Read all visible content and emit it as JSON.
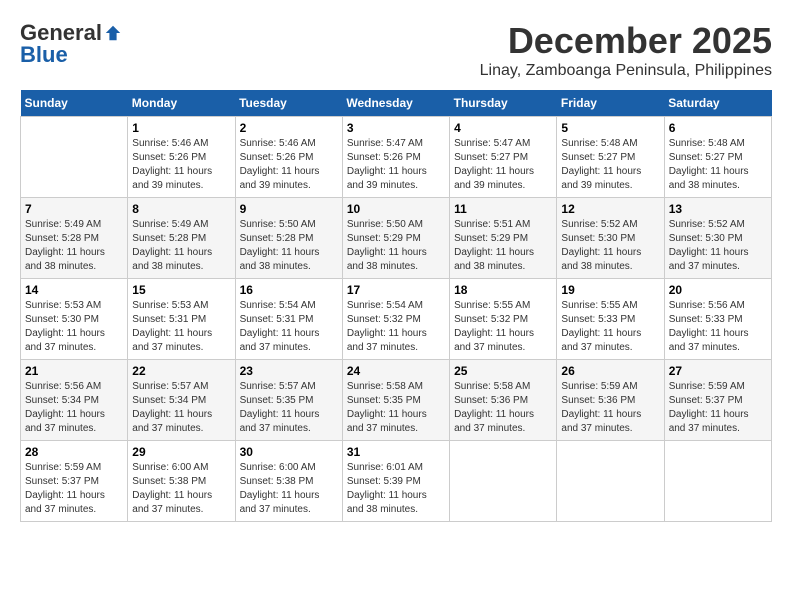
{
  "logo": {
    "general": "General",
    "blue": "Blue"
  },
  "title": {
    "month_year": "December 2025",
    "location": "Linay, Zamboanga Peninsula, Philippines"
  },
  "headers": [
    "Sunday",
    "Monday",
    "Tuesday",
    "Wednesday",
    "Thursday",
    "Friday",
    "Saturday"
  ],
  "weeks": [
    [
      {
        "day": "",
        "info": ""
      },
      {
        "day": "1",
        "info": "Sunrise: 5:46 AM\nSunset: 5:26 PM\nDaylight: 11 hours\nand 39 minutes."
      },
      {
        "day": "2",
        "info": "Sunrise: 5:46 AM\nSunset: 5:26 PM\nDaylight: 11 hours\nand 39 minutes."
      },
      {
        "day": "3",
        "info": "Sunrise: 5:47 AM\nSunset: 5:26 PM\nDaylight: 11 hours\nand 39 minutes."
      },
      {
        "day": "4",
        "info": "Sunrise: 5:47 AM\nSunset: 5:27 PM\nDaylight: 11 hours\nand 39 minutes."
      },
      {
        "day": "5",
        "info": "Sunrise: 5:48 AM\nSunset: 5:27 PM\nDaylight: 11 hours\nand 39 minutes."
      },
      {
        "day": "6",
        "info": "Sunrise: 5:48 AM\nSunset: 5:27 PM\nDaylight: 11 hours\nand 38 minutes."
      }
    ],
    [
      {
        "day": "7",
        "info": "Sunrise: 5:49 AM\nSunset: 5:28 PM\nDaylight: 11 hours\nand 38 minutes."
      },
      {
        "day": "8",
        "info": "Sunrise: 5:49 AM\nSunset: 5:28 PM\nDaylight: 11 hours\nand 38 minutes."
      },
      {
        "day": "9",
        "info": "Sunrise: 5:50 AM\nSunset: 5:28 PM\nDaylight: 11 hours\nand 38 minutes."
      },
      {
        "day": "10",
        "info": "Sunrise: 5:50 AM\nSunset: 5:29 PM\nDaylight: 11 hours\nand 38 minutes."
      },
      {
        "day": "11",
        "info": "Sunrise: 5:51 AM\nSunset: 5:29 PM\nDaylight: 11 hours\nand 38 minutes."
      },
      {
        "day": "12",
        "info": "Sunrise: 5:52 AM\nSunset: 5:30 PM\nDaylight: 11 hours\nand 38 minutes."
      },
      {
        "day": "13",
        "info": "Sunrise: 5:52 AM\nSunset: 5:30 PM\nDaylight: 11 hours\nand 37 minutes."
      }
    ],
    [
      {
        "day": "14",
        "info": "Sunrise: 5:53 AM\nSunset: 5:30 PM\nDaylight: 11 hours\nand 37 minutes."
      },
      {
        "day": "15",
        "info": "Sunrise: 5:53 AM\nSunset: 5:31 PM\nDaylight: 11 hours\nand 37 minutes."
      },
      {
        "day": "16",
        "info": "Sunrise: 5:54 AM\nSunset: 5:31 PM\nDaylight: 11 hours\nand 37 minutes."
      },
      {
        "day": "17",
        "info": "Sunrise: 5:54 AM\nSunset: 5:32 PM\nDaylight: 11 hours\nand 37 minutes."
      },
      {
        "day": "18",
        "info": "Sunrise: 5:55 AM\nSunset: 5:32 PM\nDaylight: 11 hours\nand 37 minutes."
      },
      {
        "day": "19",
        "info": "Sunrise: 5:55 AM\nSunset: 5:33 PM\nDaylight: 11 hours\nand 37 minutes."
      },
      {
        "day": "20",
        "info": "Sunrise: 5:56 AM\nSunset: 5:33 PM\nDaylight: 11 hours\nand 37 minutes."
      }
    ],
    [
      {
        "day": "21",
        "info": "Sunrise: 5:56 AM\nSunset: 5:34 PM\nDaylight: 11 hours\nand 37 minutes."
      },
      {
        "day": "22",
        "info": "Sunrise: 5:57 AM\nSunset: 5:34 PM\nDaylight: 11 hours\nand 37 minutes."
      },
      {
        "day": "23",
        "info": "Sunrise: 5:57 AM\nSunset: 5:35 PM\nDaylight: 11 hours\nand 37 minutes."
      },
      {
        "day": "24",
        "info": "Sunrise: 5:58 AM\nSunset: 5:35 PM\nDaylight: 11 hours\nand 37 minutes."
      },
      {
        "day": "25",
        "info": "Sunrise: 5:58 AM\nSunset: 5:36 PM\nDaylight: 11 hours\nand 37 minutes."
      },
      {
        "day": "26",
        "info": "Sunrise: 5:59 AM\nSunset: 5:36 PM\nDaylight: 11 hours\nand 37 minutes."
      },
      {
        "day": "27",
        "info": "Sunrise: 5:59 AM\nSunset: 5:37 PM\nDaylight: 11 hours\nand 37 minutes."
      }
    ],
    [
      {
        "day": "28",
        "info": "Sunrise: 5:59 AM\nSunset: 5:37 PM\nDaylight: 11 hours\nand 37 minutes."
      },
      {
        "day": "29",
        "info": "Sunrise: 6:00 AM\nSunset: 5:38 PM\nDaylight: 11 hours\nand 37 minutes."
      },
      {
        "day": "30",
        "info": "Sunrise: 6:00 AM\nSunset: 5:38 PM\nDaylight: 11 hours\nand 37 minutes."
      },
      {
        "day": "31",
        "info": "Sunrise: 6:01 AM\nSunset: 5:39 PM\nDaylight: 11 hours\nand 38 minutes."
      },
      {
        "day": "",
        "info": ""
      },
      {
        "day": "",
        "info": ""
      },
      {
        "day": "",
        "info": ""
      }
    ]
  ]
}
